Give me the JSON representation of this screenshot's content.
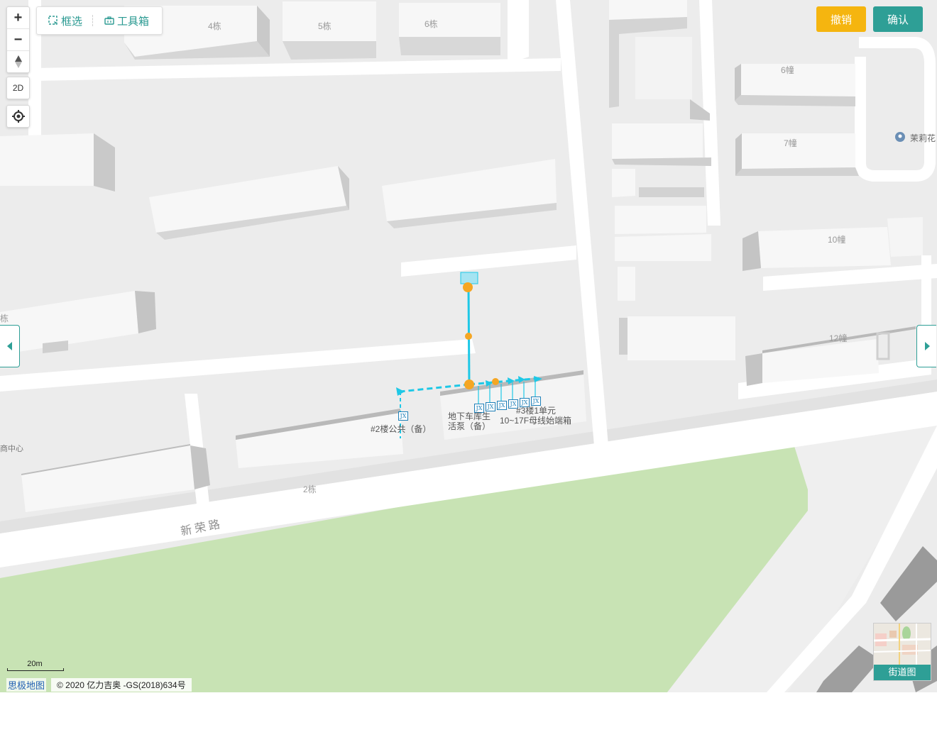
{
  "map": {
    "building_labels": {
      "b4": "4栋",
      "b5": "5栋",
      "b6top": "6栋",
      "b6right": "6幢",
      "b7": "7幢",
      "b10": "10幢",
      "b12": "12幢",
      "b2": "2栋",
      "left_fragment": "栋",
      "left_center": "商中心",
      "jasmine": "茉莉花"
    },
    "road_label": "新荣路",
    "poi_labels": {
      "building2": "#2楼公共（备）",
      "garage": "地下车库生活泵（备）",
      "garage_line1": "地下车库生",
      "garage_line2": "活泵（备）",
      "building3_line1": "#3楼1单元",
      "building3_line2": "10~17F母线始端箱"
    },
    "box_tag": "JX"
  },
  "controls": {
    "zoom_in": "+",
    "zoom_out": "−",
    "compass_icon": "compass-icon",
    "mode_2d": "2D",
    "locate_icon": "locate-icon"
  },
  "toolbar": {
    "select_label": "框选",
    "toolbox_label": "工具箱"
  },
  "actions": {
    "undo_label": "撤销",
    "confirm_label": "确认"
  },
  "footer": {
    "scale_label": "20m",
    "brand": "思极地图",
    "copyright": "© 2020 亿力吉奥 -GS(2018)634号"
  },
  "street_view": {
    "label": "街道图"
  },
  "colors": {
    "accent": "#2e9f96",
    "undo": "#f5b50f",
    "route": "#1ec8e6",
    "node": "#f5a623",
    "park": "#c8e3b4"
  }
}
